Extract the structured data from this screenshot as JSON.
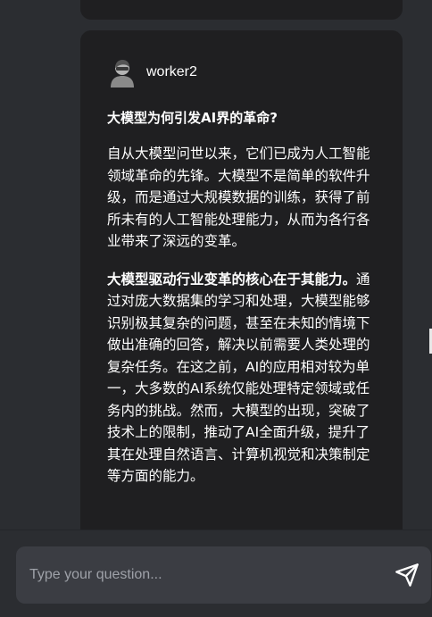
{
  "message": {
    "author": "worker2",
    "heading": "大模型为何引发AI界的革命?",
    "paragraph1": "自从大模型问世以来，它们已成为人工智能领域革命的先锋。大模型不是简单的软件升级，而是通过大规模数据的训练，获得了前所未有的人工智能处理能力，从而为各行各业带来了深远的变革。",
    "paragraph2_bold": "大模型驱动行业变革的核心在于其能力。",
    "paragraph2_rest": "通过对庞大数据集的学习和处理，大模型能够识别极其复杂的问题，甚至在未知的情境下做出准确的回答，解决以前需要人类处理的复杂任务。在这之前，AI的应用相对较为单一，大多数的AI系统仅能处理特定领域或任务内的挑战。然而，大模型的出现，突破了技术上的限制，推动了AI全面升级，提升了其在处理自然语言、计算机视觉和决策制定等方面的能力。"
  },
  "composer": {
    "placeholder": "Type your question...",
    "value": ""
  },
  "icons": {
    "avatar": "user-avatar-icon",
    "send": "send-icon"
  },
  "colors": {
    "background": "#2b2d31",
    "card": "#1f1f21",
    "input": "#3b3d43",
    "text": "#ffffff",
    "placeholder": "#9ea1a8"
  }
}
